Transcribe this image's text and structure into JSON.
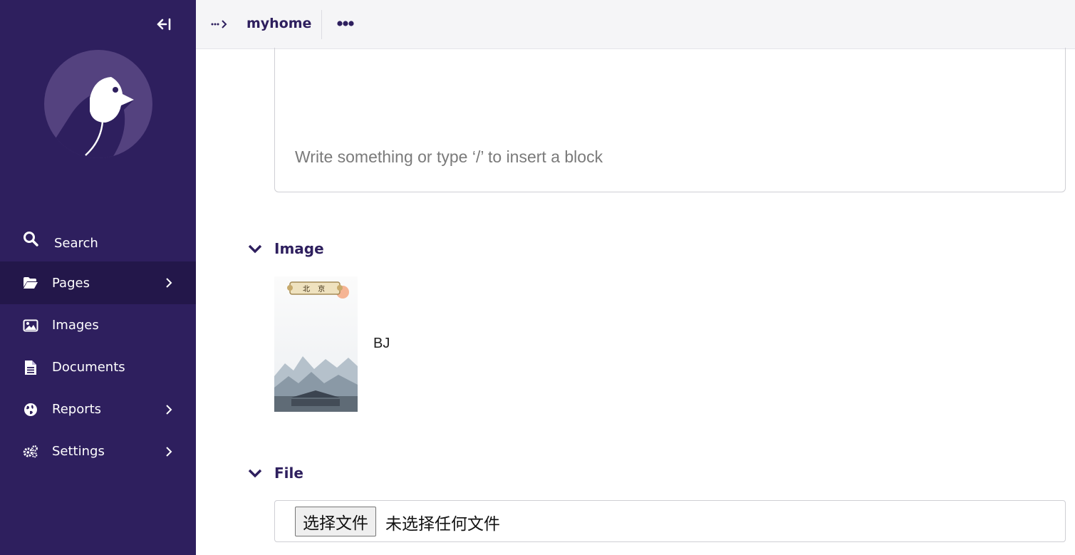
{
  "sidebar": {
    "items": [
      {
        "label": "Search",
        "icon": "search-icon"
      },
      {
        "label": "Pages",
        "icon": "folder-open-icon",
        "has_submenu": true,
        "active": true
      },
      {
        "label": "Images",
        "icon": "image-icon"
      },
      {
        "label": "Documents",
        "icon": "document-icon"
      },
      {
        "label": "Reports",
        "icon": "globe-icon",
        "has_submenu": true
      },
      {
        "label": "Settings",
        "icon": "gears-icon",
        "has_submenu": true
      }
    ],
    "colors": {
      "background": "#2e1f5e",
      "active": "#23174a"
    }
  },
  "header": {
    "breadcrumb_title": "myhome"
  },
  "main": {
    "editor_placeholder": "Write something or type ‘/’ to insert a block",
    "image_section": {
      "title": "Image",
      "image_name": "BJ",
      "thumbnail_caption": "北 京"
    },
    "file_section": {
      "title": "File",
      "button_label": "选择文件",
      "status": "未选择任何文件"
    }
  }
}
